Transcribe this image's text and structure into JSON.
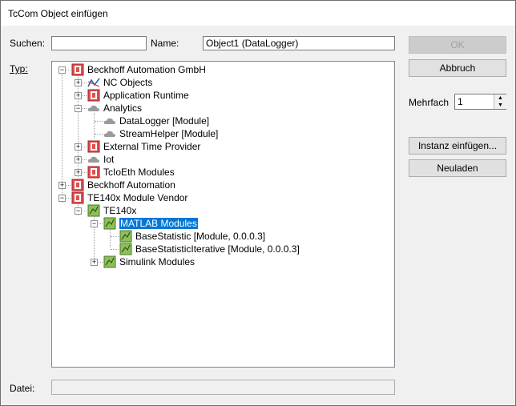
{
  "window": {
    "title": "TcCom Object einfügen"
  },
  "labels": {
    "search": "Suchen:",
    "name": "Name:",
    "type": "Typ:",
    "multiple": "Mehrfach",
    "file": "Datei:"
  },
  "fields": {
    "search_value": "",
    "name_value": "Object1 (DataLogger)",
    "multiple_value": "1",
    "file_value": ""
  },
  "buttons": {
    "ok": "OK",
    "cancel": "Abbruch",
    "insert_instance": "Instanz einfügen...",
    "reload": "Neuladen"
  },
  "tree": [
    {
      "label": "Beckhoff Automation GmbH",
      "icon": "beckhoff-icon",
      "exp": "minus"
    },
    {
      "label": "NC Objects",
      "icon": "nc-icon",
      "exp": "plus"
    },
    {
      "label": "Application Runtime",
      "icon": "beckhoff-icon",
      "exp": "plus"
    },
    {
      "label": "Analytics",
      "icon": "cloud-icon",
      "exp": "minus"
    },
    {
      "label": "DataLogger [Module]",
      "icon": "cloud-icon"
    },
    {
      "label": "StreamHelper [Module]",
      "icon": "cloud-icon"
    },
    {
      "label": "External Time Provider",
      "icon": "beckhoff-icon",
      "exp": "plus"
    },
    {
      "label": "Iot",
      "icon": "cloud-icon",
      "exp": "plus"
    },
    {
      "label": "TcIoEth Modules",
      "icon": "beckhoff-icon",
      "exp": "plus"
    },
    {
      "label": "Beckhoff Automation",
      "icon": "beckhoff-icon",
      "exp": "plus"
    },
    {
      "label": "TE140x Module Vendor",
      "icon": "beckhoff-icon",
      "exp": "minus"
    },
    {
      "label": "TE140x",
      "icon": "matlab-module-icon",
      "exp": "minus"
    },
    {
      "label": "MATLAB Modules",
      "icon": "matlab-module-icon",
      "exp": "minus",
      "selected": true
    },
    {
      "label": "BaseStatistic [Module, 0.0.0.3]",
      "icon": "matlab-module-icon"
    },
    {
      "label": "BaseStatisticIterative [Module, 0.0.0.3]",
      "icon": "matlab-module-icon"
    },
    {
      "label": "Simulink Modules",
      "icon": "matlab-module-icon",
      "exp": "plus"
    }
  ]
}
